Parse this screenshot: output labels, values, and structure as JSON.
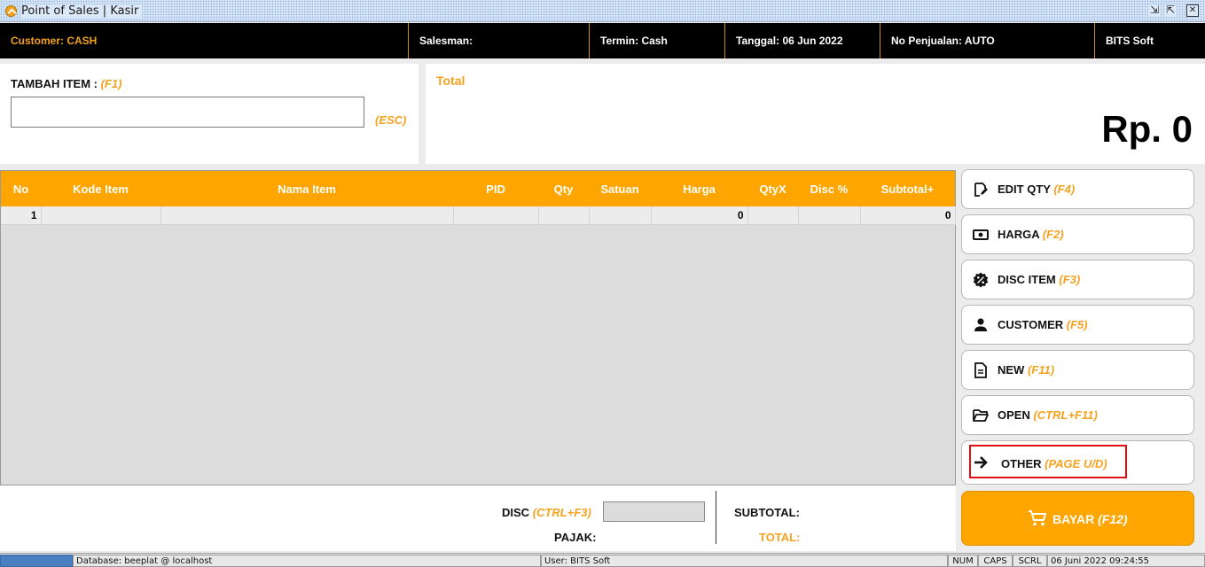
{
  "window": {
    "title": "Point of Sales | Kasir",
    "controls": {
      "minimize": "⇲",
      "restore": "⇱",
      "close": "✕"
    }
  },
  "infobar": {
    "customer": "Customer:  CASH",
    "salesman": "Salesman:",
    "termin": "Termin:  Cash",
    "tanggal": "Tanggal:  06 Jun 2022",
    "no_penjualan": "No Penjualan:  AUTO",
    "company": "BITS Soft"
  },
  "add_item": {
    "label": "TAMBAH ITEM : ",
    "shortcut": "(F1)",
    "value": "",
    "esc": "(ESC)"
  },
  "total_panel": {
    "label": "Total",
    "value": "Rp. 0"
  },
  "table": {
    "columns": [
      "No",
      "Kode Item",
      "Nama Item",
      "PID",
      "Qty",
      "Satuan",
      "Harga",
      "QtyX",
      "Disc %",
      "Subtotal+"
    ],
    "rows": [
      [
        "1",
        "",
        "",
        "",
        "",
        "",
        "0",
        "",
        "",
        "0"
      ]
    ]
  },
  "actions": [
    {
      "label": "EDIT QTY",
      "key": "(F4)",
      "icon": "edit-icon"
    },
    {
      "label": "HARGA",
      "key": "(F2)",
      "icon": "money-icon"
    },
    {
      "label": "DISC ITEM",
      "key": "(F3)",
      "icon": "discount-badge-icon"
    },
    {
      "label": "CUSTOMER",
      "key": "(F5)",
      "icon": "person-icon"
    },
    {
      "label": "NEW",
      "key": "(F11)",
      "icon": "document-icon"
    },
    {
      "label": "OPEN",
      "key": "(CTRL+F11)",
      "icon": "folder-open-icon"
    },
    {
      "label": "OTHER",
      "key": "(PAGE U/D)",
      "icon": "arrow-right-icon"
    }
  ],
  "bayar": {
    "label": "BAYAR",
    "key": "(F12)",
    "icon": "cart-icon"
  },
  "summary": {
    "disc_label": "DISC",
    "disc_key": "(CTRL+F3)",
    "disc_value": "",
    "pajak_label": "PAJAK:",
    "subtotal_label": "SUBTOTAL:",
    "total_label": "TOTAL:"
  },
  "statusbar": {
    "database": "Database: beeplat @ localhost",
    "user": "User: BITS Soft",
    "num": "NUM",
    "caps": "CAPS",
    "scrl": "SCRL",
    "datetime": "06 Juni 2022  09:24:55"
  },
  "colors": {
    "accent": "#fea500",
    "highlight": "#e01010",
    "infobar": "#000000"
  }
}
